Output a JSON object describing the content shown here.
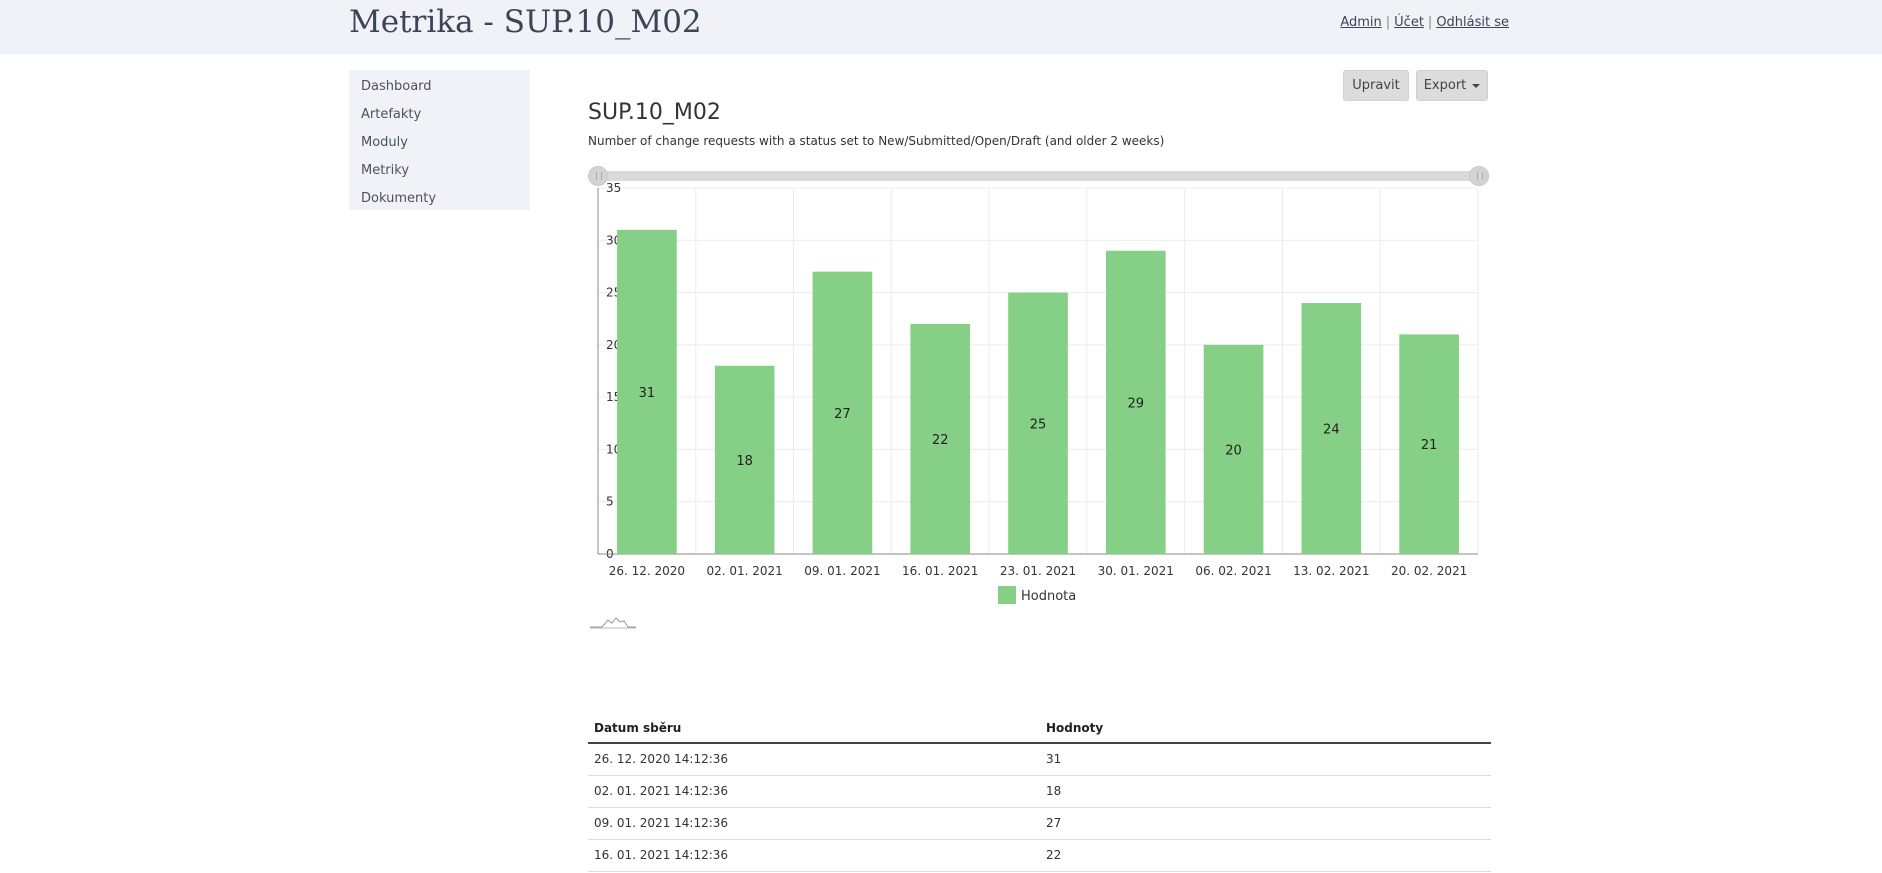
{
  "header": {
    "app_title": "Metrika - SUP.10_M02",
    "nav": {
      "admin": "Admin",
      "account": "Účet",
      "logout": "Odhlásit se"
    }
  },
  "sidebar": {
    "items": [
      {
        "label": "Dashboard"
      },
      {
        "label": "Artefakty"
      },
      {
        "label": "Moduly"
      },
      {
        "label": "Metriky"
      },
      {
        "label": "Dokumenty"
      }
    ]
  },
  "actions": {
    "edit_label": "Upravit",
    "export_label": "Export"
  },
  "metric": {
    "title": "SUP.10_M02",
    "description": "Number of change requests with a status set to New/Submitted/Open/Draft (and older 2 weeks)"
  },
  "chart_data": {
    "type": "bar",
    "categories": [
      "26. 12. 2020",
      "02. 01. 2021",
      "09. 01. 2021",
      "16. 01. 2021",
      "23. 01. 2021",
      "30. 01. 2021",
      "06. 02. 2021",
      "13. 02. 2021",
      "20. 02. 2021"
    ],
    "series": [
      {
        "name": "Hodnota",
        "values": [
          31,
          18,
          27,
          22,
          25,
          29,
          20,
          24,
          21
        ]
      }
    ],
    "ylim": [
      0,
      35
    ],
    "yticks": [
      0,
      5,
      10,
      15,
      20,
      25,
      30,
      35
    ],
    "grid": true,
    "legend": "bottom-center",
    "bar_color": "#86cf86",
    "data_labels": true
  },
  "table": {
    "headers": [
      "Datum sběru",
      "Hodnoty"
    ],
    "rows": [
      [
        "26. 12. 2020 14:12:36",
        "31"
      ],
      [
        "02. 01. 2021 14:12:36",
        "18"
      ],
      [
        "09. 01. 2021 14:12:36",
        "27"
      ],
      [
        "16. 01. 2021 14:12:36",
        "22"
      ]
    ]
  }
}
